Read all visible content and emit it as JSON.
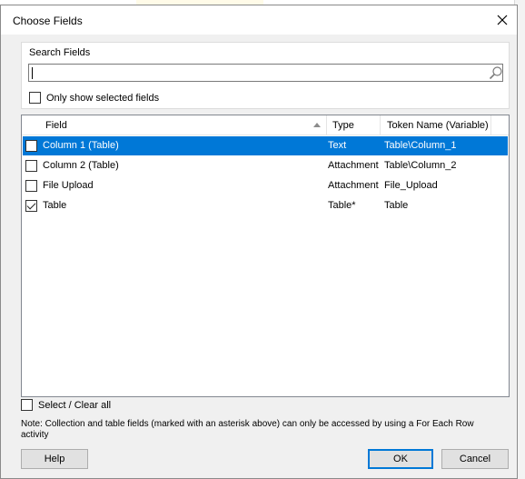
{
  "dialog": {
    "title": "Choose Fields"
  },
  "search": {
    "group_label": "Search Fields",
    "value": "",
    "only_selected_label": "Only show selected fields",
    "only_selected_checked": false
  },
  "list": {
    "columns": [
      "Field",
      "Type",
      "Token Name (Variable)"
    ],
    "sort_column": "Field",
    "sort_direction": "ascending",
    "rows": [
      {
        "field": "Column 1 (Table)",
        "type": "Text",
        "token": "Table\\Column_1",
        "checked": false,
        "selected": true
      },
      {
        "field": "Column 2 (Table)",
        "type": "Attachment",
        "token": "Table\\Column_2",
        "checked": false,
        "selected": false
      },
      {
        "field": "File Upload",
        "type": "Attachment",
        "token": "File_Upload",
        "checked": false,
        "selected": false
      },
      {
        "field": "Table",
        "type": "Table*",
        "token": "Table",
        "checked": true,
        "selected": false
      }
    ]
  },
  "footer": {
    "select_clear_label": "Select / Clear all",
    "select_clear_checked": false,
    "note": "Note: Collection and table fields (marked with an asterisk above) can only be accessed by using a For Each Row activity",
    "help_label": "Help",
    "ok_label": "OK",
    "cancel_label": "Cancel"
  },
  "colors": {
    "selection": "#0078d7",
    "dialog_bg": "#f0f0f0"
  }
}
